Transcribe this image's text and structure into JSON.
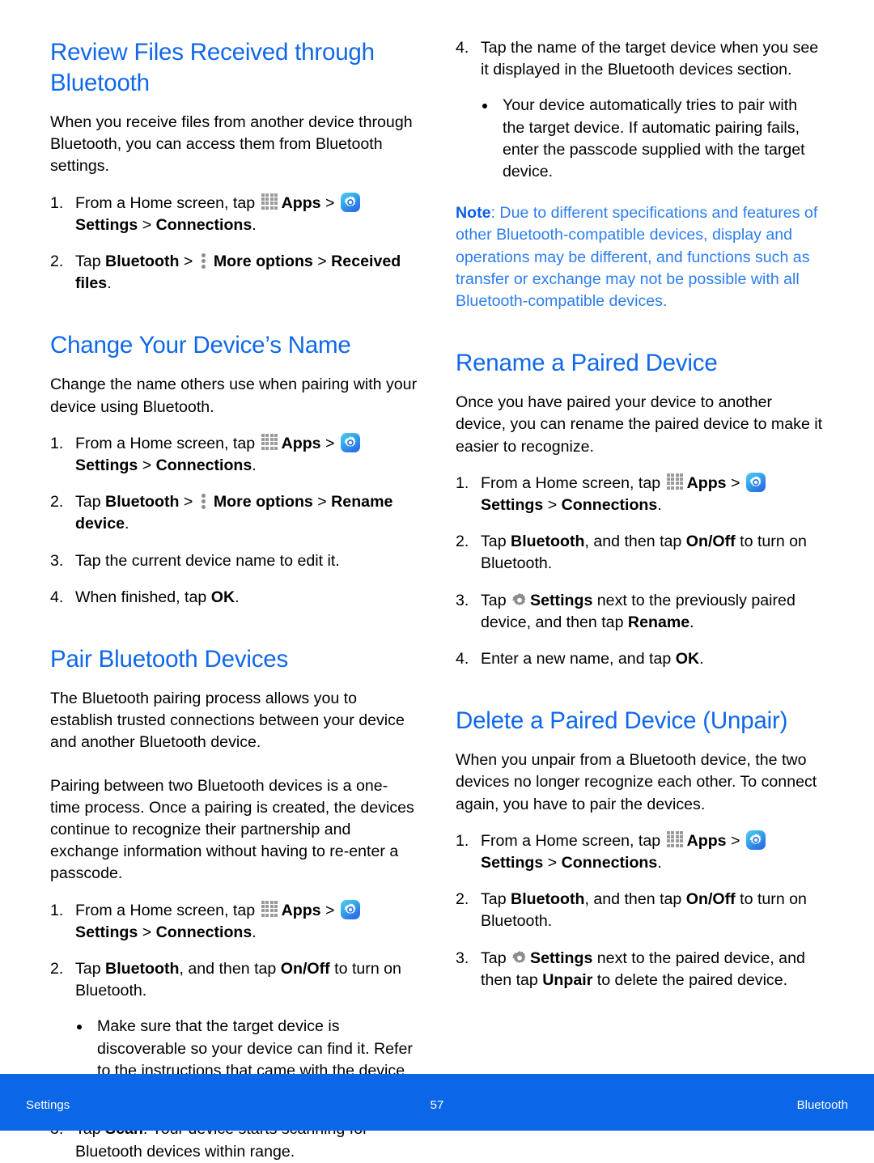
{
  "page": {
    "accent_blue": "#1068e8",
    "note_blue": "#2b7df0",
    "footer_blue": "#0b66e8"
  },
  "icons": {
    "apps": "apps-grid-icon",
    "settings_app": "settings-app-icon",
    "more_options": "more-options-icon",
    "gear": "gear-icon"
  },
  "left_column": {
    "sections": [
      {
        "id": "review-files",
        "title": "Review Files Received through Bluetooth",
        "intro": "When you receive files from another device through Bluetooth, you can access them from Bluetooth settings.",
        "steps": [
          {
            "num": "1.",
            "pre": "From a Home screen, tap ",
            "apps_label": "Apps",
            "sep1": " > ",
            "settings_label": "Settings",
            "tail": " > ",
            "tail_bold": "Connections",
            "tail_end": "."
          },
          {
            "num": "2.",
            "pre": "Tap ",
            "bold1": "Bluetooth",
            "mid": " > ",
            "more_label": "More options",
            "mid2": " > ",
            "bold2": "Received files",
            "tail_end": "."
          }
        ]
      },
      {
        "id": "change-device-name",
        "title": "Change Your Device’s Name",
        "intro": "Change the name others use when pairing with your device using Bluetooth.",
        "steps": [
          {
            "num": "1.",
            "pre": "From a Home screen, tap ",
            "apps_label": "Apps",
            "sep1": " > ",
            "settings_label": "Settings",
            "tail": " > ",
            "tail_bold": "Connections",
            "tail_end": "."
          },
          {
            "num": "2.",
            "pre": "Tap ",
            "bold1": "Bluetooth",
            "mid": " > ",
            "more_label": "More options",
            "mid2": " > ",
            "bold2": "Rename device",
            "tail_end": "."
          },
          {
            "num": "3.",
            "plain": "Tap the current device name to edit it."
          },
          {
            "num": "4.",
            "pre": "When finished, tap ",
            "bold1": "OK",
            "tail_end": "."
          }
        ]
      },
      {
        "id": "pair-bluetooth-devices",
        "title": "Pair Bluetooth Devices",
        "intro": "The Bluetooth pairing process allows you to establish trusted connections between your device and another Bluetooth device.",
        "intro2": "Pairing between two Bluetooth devices is a one-time process. Once a pairing is created, the devices continue to recognize their partnership and exchange information without having to re-enter a passcode.",
        "steps": [
          {
            "num": "1.",
            "pre": "From a Home screen, tap ",
            "apps_label": "Apps",
            "sep1": " > ",
            "settings_label": "Settings",
            "tail": " > ",
            "tail_bold": "Connections",
            "tail_end": "."
          },
          {
            "num": "2.",
            "pre": "Tap ",
            "bold1": "Bluetooth",
            "mid": ", and then tap ",
            "bold2": "On/Off",
            "tail_plain": " to turn on Bluetooth.",
            "bullets": [
              "Make sure that the target device is discoverable so your device can find it. Refer to the instructions that came with the device to find out how to set it to discoverable mode."
            ]
          },
          {
            "num": "3.",
            "pre": "Tap ",
            "bold1": "Scan",
            "tail_plain": ". Your device starts scanning for Bluetooth devices within range."
          }
        ]
      }
    ]
  },
  "right_column": {
    "continued_step": {
      "num": "4.",
      "text": "Tap the name of the target device when you see it displayed in the Bluetooth devices section.",
      "bullets": [
        "Your device automatically tries to pair with the target device. If automatic pairing fails, enter the passcode supplied with the target device."
      ]
    },
    "note": {
      "label": "Note",
      "text": ": Due to different specifications and features of other Bluetooth-compatible devices, display and operations may be different, and functions such as transfer or exchange may not be possible with all Bluetooth-compatible devices."
    },
    "sections": [
      {
        "id": "rename-paired-device",
        "title": "Rename a Paired Device",
        "intro": "Once you have paired your device to another device, you can rename the paired device to make it easier to recognize.",
        "steps": [
          {
            "num": "1.",
            "pre": "From a Home screen, tap ",
            "apps_label": "Apps",
            "sep1": " > ",
            "settings_label": "Settings",
            "tail": " > ",
            "tail_bold": "Connections",
            "tail_end": "."
          },
          {
            "num": "2.",
            "pre": "Tap ",
            "bold1": "Bluetooth",
            "mid": ", and then tap ",
            "bold2": "On/Off",
            "tail_plain": " to turn on Bluetooth."
          },
          {
            "num": "3.",
            "pre": "Tap ",
            "gear_label": "Settings",
            "mid": " next to the previously paired device, and then tap ",
            "bold2": "Rename",
            "tail_end": "."
          },
          {
            "num": "4.",
            "pre": "Enter a new name, and tap ",
            "bold1": "OK",
            "tail_end": "."
          }
        ]
      },
      {
        "id": "delete-paired-device",
        "title": "Delete a Paired Device (Unpair)",
        "intro": "When you unpair from a Bluetooth device, the two devices no longer recognize each other. To connect again, you have to pair the devices.",
        "steps": [
          {
            "num": "1.",
            "pre": "From a Home screen, tap ",
            "apps_label": "Apps",
            "sep1": " > ",
            "settings_label": "Settings",
            "tail": " > ",
            "tail_bold": "Connections",
            "tail_end": "."
          },
          {
            "num": "2.",
            "pre": "Tap ",
            "bold1": "Bluetooth",
            "mid": ", and then tap ",
            "bold2": "On/Off",
            "tail_plain": " to turn on Bluetooth."
          },
          {
            "num": "3.",
            "pre": "Tap ",
            "gear_label": "Settings",
            "mid": " next to the paired device, and then tap ",
            "bold2": "Unpair",
            "tail_plain": " to delete the paired device."
          }
        ]
      }
    ]
  },
  "footer": {
    "left": "Settings",
    "page_number": "57",
    "right": "Bluetooth"
  }
}
